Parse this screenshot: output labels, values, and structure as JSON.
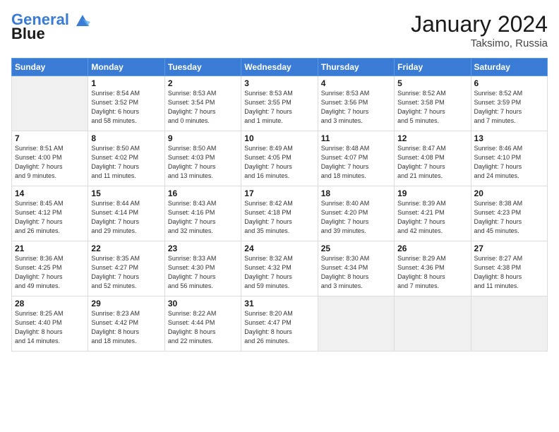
{
  "header": {
    "logo_line1": "General",
    "logo_line2": "Blue",
    "month": "January 2024",
    "location": "Taksimo, Russia"
  },
  "days_of_week": [
    "Sunday",
    "Monday",
    "Tuesday",
    "Wednesday",
    "Thursday",
    "Friday",
    "Saturday"
  ],
  "weeks": [
    [
      {
        "day": "",
        "info": "",
        "empty": true
      },
      {
        "day": "1",
        "info": "Sunrise: 8:54 AM\nSunset: 3:52 PM\nDaylight: 6 hours\nand 58 minutes."
      },
      {
        "day": "2",
        "info": "Sunrise: 8:53 AM\nSunset: 3:54 PM\nDaylight: 7 hours\nand 0 minutes."
      },
      {
        "day": "3",
        "info": "Sunrise: 8:53 AM\nSunset: 3:55 PM\nDaylight: 7 hours\nand 1 minute."
      },
      {
        "day": "4",
        "info": "Sunrise: 8:53 AM\nSunset: 3:56 PM\nDaylight: 7 hours\nand 3 minutes."
      },
      {
        "day": "5",
        "info": "Sunrise: 8:52 AM\nSunset: 3:58 PM\nDaylight: 7 hours\nand 5 minutes."
      },
      {
        "day": "6",
        "info": "Sunrise: 8:52 AM\nSunset: 3:59 PM\nDaylight: 7 hours\nand 7 minutes."
      }
    ],
    [
      {
        "day": "7",
        "info": "Sunrise: 8:51 AM\nSunset: 4:00 PM\nDaylight: 7 hours\nand 9 minutes."
      },
      {
        "day": "8",
        "info": "Sunrise: 8:50 AM\nSunset: 4:02 PM\nDaylight: 7 hours\nand 11 minutes."
      },
      {
        "day": "9",
        "info": "Sunrise: 8:50 AM\nSunset: 4:03 PM\nDaylight: 7 hours\nand 13 minutes."
      },
      {
        "day": "10",
        "info": "Sunrise: 8:49 AM\nSunset: 4:05 PM\nDaylight: 7 hours\nand 16 minutes."
      },
      {
        "day": "11",
        "info": "Sunrise: 8:48 AM\nSunset: 4:07 PM\nDaylight: 7 hours\nand 18 minutes."
      },
      {
        "day": "12",
        "info": "Sunrise: 8:47 AM\nSunset: 4:08 PM\nDaylight: 7 hours\nand 21 minutes."
      },
      {
        "day": "13",
        "info": "Sunrise: 8:46 AM\nSunset: 4:10 PM\nDaylight: 7 hours\nand 24 minutes."
      }
    ],
    [
      {
        "day": "14",
        "info": "Sunrise: 8:45 AM\nSunset: 4:12 PM\nDaylight: 7 hours\nand 26 minutes."
      },
      {
        "day": "15",
        "info": "Sunrise: 8:44 AM\nSunset: 4:14 PM\nDaylight: 7 hours\nand 29 minutes."
      },
      {
        "day": "16",
        "info": "Sunrise: 8:43 AM\nSunset: 4:16 PM\nDaylight: 7 hours\nand 32 minutes."
      },
      {
        "day": "17",
        "info": "Sunrise: 8:42 AM\nSunset: 4:18 PM\nDaylight: 7 hours\nand 35 minutes."
      },
      {
        "day": "18",
        "info": "Sunrise: 8:40 AM\nSunset: 4:20 PM\nDaylight: 7 hours\nand 39 minutes."
      },
      {
        "day": "19",
        "info": "Sunrise: 8:39 AM\nSunset: 4:21 PM\nDaylight: 7 hours\nand 42 minutes."
      },
      {
        "day": "20",
        "info": "Sunrise: 8:38 AM\nSunset: 4:23 PM\nDaylight: 7 hours\nand 45 minutes."
      }
    ],
    [
      {
        "day": "21",
        "info": "Sunrise: 8:36 AM\nSunset: 4:25 PM\nDaylight: 7 hours\nand 49 minutes."
      },
      {
        "day": "22",
        "info": "Sunrise: 8:35 AM\nSunset: 4:27 PM\nDaylight: 7 hours\nand 52 minutes."
      },
      {
        "day": "23",
        "info": "Sunrise: 8:33 AM\nSunset: 4:30 PM\nDaylight: 7 hours\nand 56 minutes."
      },
      {
        "day": "24",
        "info": "Sunrise: 8:32 AM\nSunset: 4:32 PM\nDaylight: 7 hours\nand 59 minutes."
      },
      {
        "day": "25",
        "info": "Sunrise: 8:30 AM\nSunset: 4:34 PM\nDaylight: 8 hours\nand 3 minutes."
      },
      {
        "day": "26",
        "info": "Sunrise: 8:29 AM\nSunset: 4:36 PM\nDaylight: 8 hours\nand 7 minutes."
      },
      {
        "day": "27",
        "info": "Sunrise: 8:27 AM\nSunset: 4:38 PM\nDaylight: 8 hours\nand 11 minutes."
      }
    ],
    [
      {
        "day": "28",
        "info": "Sunrise: 8:25 AM\nSunset: 4:40 PM\nDaylight: 8 hours\nand 14 minutes."
      },
      {
        "day": "29",
        "info": "Sunrise: 8:23 AM\nSunset: 4:42 PM\nDaylight: 8 hours\nand 18 minutes."
      },
      {
        "day": "30",
        "info": "Sunrise: 8:22 AM\nSunset: 4:44 PM\nDaylight: 8 hours\nand 22 minutes."
      },
      {
        "day": "31",
        "info": "Sunrise: 8:20 AM\nSunset: 4:47 PM\nDaylight: 8 hours\nand 26 minutes."
      },
      {
        "day": "",
        "info": "",
        "empty": true
      },
      {
        "day": "",
        "info": "",
        "empty": true
      },
      {
        "day": "",
        "info": "",
        "empty": true
      }
    ]
  ]
}
